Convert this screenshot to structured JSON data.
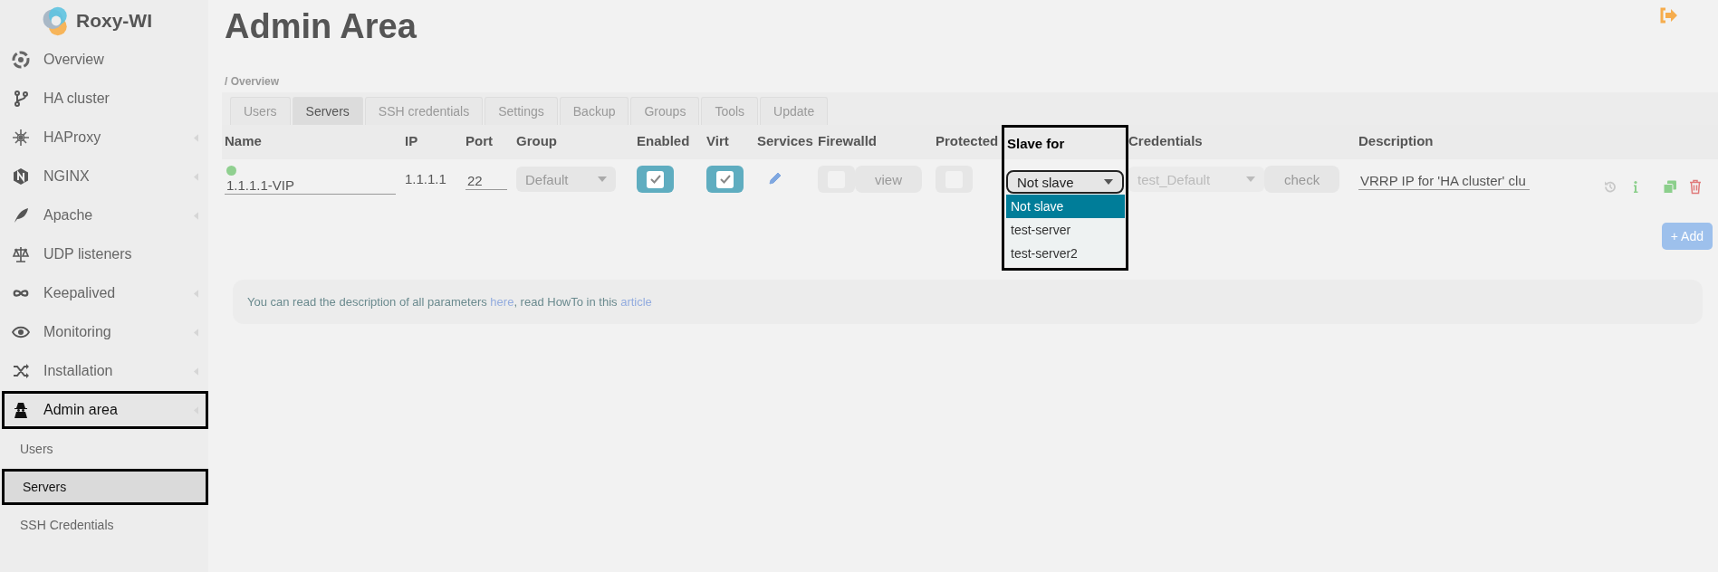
{
  "app": {
    "name": "Roxy-WI"
  },
  "sidebar": {
    "items": [
      {
        "label": "Overview",
        "kind": "overview",
        "expandable": false,
        "outlined": false
      },
      {
        "label": "HA cluster",
        "kind": "branch",
        "expandable": false,
        "outlined": false
      },
      {
        "label": "HAProxy",
        "kind": "snowflake",
        "expandable": true,
        "outlined": false
      },
      {
        "label": "NGINX",
        "kind": "hexagon",
        "expandable": true,
        "outlined": false
      },
      {
        "label": "Apache",
        "kind": "feather",
        "expandable": true,
        "outlined": false
      },
      {
        "label": "UDP listeners",
        "kind": "scales",
        "expandable": false,
        "outlined": false
      },
      {
        "label": "Keepalived",
        "kind": "infinity",
        "expandable": true,
        "outlined": false
      },
      {
        "label": "Monitoring",
        "kind": "eye",
        "expandable": true,
        "outlined": false
      },
      {
        "label": "Installation",
        "kind": "shuffle",
        "expandable": true,
        "outlined": false
      },
      {
        "label": "Admin area",
        "kind": "spy",
        "expandable": true,
        "outlined": true
      }
    ],
    "subitems": [
      {
        "label": "Users",
        "selected": false,
        "outlined": false
      },
      {
        "label": "Servers",
        "selected": true,
        "outlined": true
      },
      {
        "label": "SSH Credentials",
        "selected": false,
        "outlined": false
      }
    ]
  },
  "page": {
    "title": "Admin Area",
    "breadcrumb": "/ Overview"
  },
  "tabs": [
    {
      "label": "Users",
      "selected": false
    },
    {
      "label": "Servers",
      "selected": true
    },
    {
      "label": "SSH credentials",
      "selected": false
    },
    {
      "label": "Settings",
      "selected": false
    },
    {
      "label": "Backup",
      "selected": false
    },
    {
      "label": "Groups",
      "selected": false
    },
    {
      "label": "Tools",
      "selected": false
    },
    {
      "label": "Update",
      "selected": false
    }
  ],
  "table": {
    "columns": [
      {
        "label": "Name",
        "outlined": false
      },
      {
        "label": "IP",
        "outlined": false
      },
      {
        "label": "Port",
        "outlined": false
      },
      {
        "label": "Group",
        "outlined": false
      },
      {
        "label": "Enabled",
        "outlined": false
      },
      {
        "label": "Virt",
        "outlined": false
      },
      {
        "label": "Services",
        "outlined": false
      },
      {
        "label": "Firewalld",
        "outlined": false
      },
      {
        "label": "Protected",
        "outlined": false
      },
      {
        "label": "Slave for",
        "outlined": true
      },
      {
        "label": "Credentials",
        "outlined": false
      },
      {
        "label": "Description",
        "outlined": false
      }
    ],
    "rows": [
      {
        "color": "#90d090",
        "name": "1.1.1.1-VIP",
        "ip": "1.1.1.1",
        "port": "22",
        "group": "Default",
        "enabled": true,
        "virt": true,
        "firewalld": false,
        "firewalld_button": "view",
        "protected": false,
        "slave_for": {
          "value": "Not slave",
          "open": true,
          "options": [
            {
              "label": "Not slave",
              "selected": true
            },
            {
              "label": "test-server",
              "selected": false
            },
            {
              "label": "test-server2",
              "selected": false
            }
          ]
        },
        "credentials": "test_Default",
        "check_button": "check",
        "description": "VRRP IP for 'HA cluster' clu"
      }
    ]
  },
  "add_button": "+ Add",
  "info": {
    "parts": [
      {
        "kind": "text",
        "text": "You can read the description of all parameters "
      },
      {
        "kind": "link",
        "text": "here"
      },
      {
        "kind": "text",
        "text": ", read HowTo in this "
      },
      {
        "kind": "link",
        "text": "article"
      }
    ]
  }
}
